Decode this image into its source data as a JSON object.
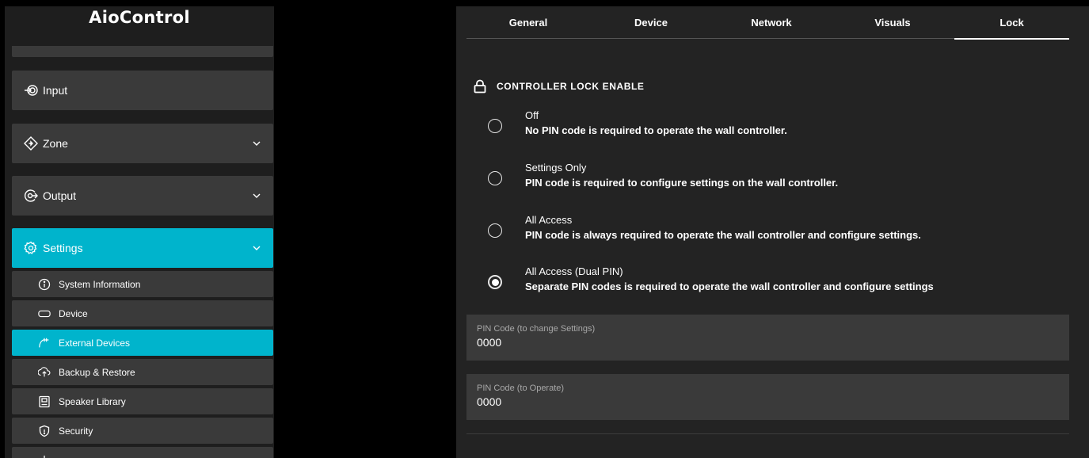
{
  "app": {
    "title": "AioControl"
  },
  "sidebar": {
    "nav": [
      {
        "label": "Input",
        "icon": "input-icon",
        "chevron": false
      },
      {
        "label": "Zone",
        "icon": "zone-icon",
        "chevron": true
      },
      {
        "label": "Output",
        "icon": "output-icon",
        "chevron": true
      },
      {
        "label": "Settings",
        "icon": "settings-icon",
        "chevron": true
      }
    ],
    "settings_items": [
      {
        "label": "System Information",
        "icon": "info-icon"
      },
      {
        "label": "Device",
        "icon": "device-icon"
      },
      {
        "label": "External Devices",
        "icon": "external-devices-icon"
      },
      {
        "label": "Backup & Restore",
        "icon": "backup-restore-icon"
      },
      {
        "label": "Speaker Library",
        "icon": "speaker-library-icon"
      },
      {
        "label": "Security",
        "icon": "shield-icon"
      }
    ],
    "active_nav": "Settings",
    "active_sub": "External Devices"
  },
  "tabs": {
    "items": [
      "General",
      "Device",
      "Network",
      "Visuals",
      "Lock"
    ],
    "active": "Lock"
  },
  "lock": {
    "header": "CONTROLLER LOCK ENABLE",
    "options": [
      {
        "title": "Off",
        "desc": "No PIN code is required to operate the wall controller.",
        "checked": false
      },
      {
        "title": "Settings Only",
        "desc": "PIN code is required to configure settings on the wall controller.",
        "checked": false
      },
      {
        "title": "All Access",
        "desc": "PIN code is always required to operate the wall controller and configure settings.",
        "checked": false
      },
      {
        "title": "All Access (Dual PIN)",
        "desc": "Separate PIN codes is required to operate the wall controller and configure settings",
        "checked": true
      }
    ],
    "fields": [
      {
        "label": "PIN Code (to change Settings)",
        "value": "0000"
      },
      {
        "label": "PIN Code (to Operate)",
        "value": "0000"
      }
    ]
  },
  "colors": {
    "accent": "#00b4cc",
    "panel": "#232323",
    "item": "#3a3a3a",
    "background": "#000000"
  }
}
